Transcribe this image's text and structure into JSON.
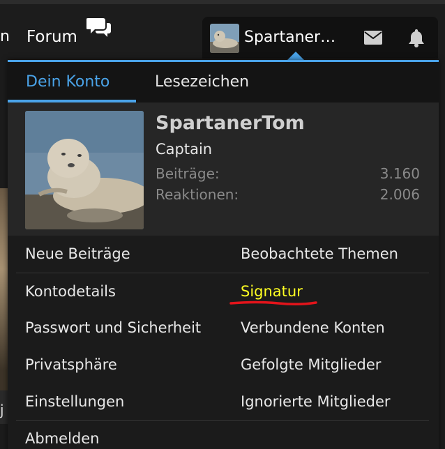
{
  "nav": {
    "cut_label": "n",
    "forum_label": "Forum",
    "username_short": "Spartaner…"
  },
  "tabs": [
    {
      "label": "Dein Konto",
      "active": true
    },
    {
      "label": "Lesezeichen",
      "active": false
    }
  ],
  "profile": {
    "username": "SpartanerTom",
    "title": "Captain",
    "stats": [
      {
        "label": "Beiträge:",
        "value": "3.160"
      },
      {
        "label": "Reaktionen:",
        "value": "2.006"
      }
    ]
  },
  "menu": {
    "left": [
      "Neue Beiträge",
      "Kontodetails",
      "Passwort und Sicherheit",
      "Privatsphäre",
      "Einstellungen"
    ],
    "right": [
      "Beobachtete Themen",
      "Signatur",
      "Verbundene Konten",
      "Gefolgte Mitglieder",
      "Ignorierte Mitglieder"
    ],
    "logout": "Abmelden"
  },
  "background": {
    "sliver_text": "j"
  },
  "colors": {
    "accent": "#4aa3e8",
    "highlight": "#ffff22",
    "annotation": "#e3141b"
  },
  "icons": [
    "chat-icon",
    "mail-icon",
    "bell-icon"
  ]
}
